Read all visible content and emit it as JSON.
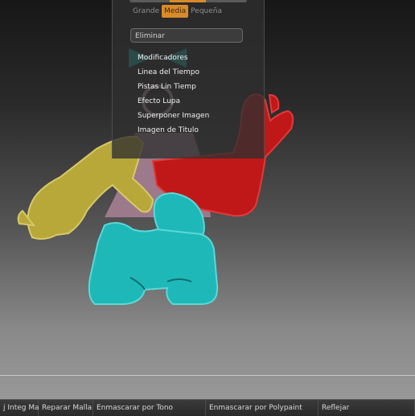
{
  "panel": {
    "size_options": [
      "Grande",
      "Media",
      "Pequeña"
    ],
    "size_selected": "Media",
    "eliminar_label": "Eliminar",
    "menu_items": [
      "Modificadores",
      "Linea del Tiempo",
      "Pistas Lin Tiemp",
      "Efecto Lupa",
      "Superponer Imagen",
      "Imagen de Titulo"
    ]
  },
  "bottom_bar": {
    "buttons": [
      "j Integ Mall",
      "Reparar Malla",
      "Enmascarar por Tono",
      "Enmascarar por Polypaint",
      "Reflejar"
    ]
  },
  "colors": {
    "accent": "#d98a2b",
    "mask_yellow": "#b8a83a",
    "mask_red": "#c01818",
    "mask_cyan": "#1fb8b8",
    "body_pink": "#9c7a8c"
  }
}
